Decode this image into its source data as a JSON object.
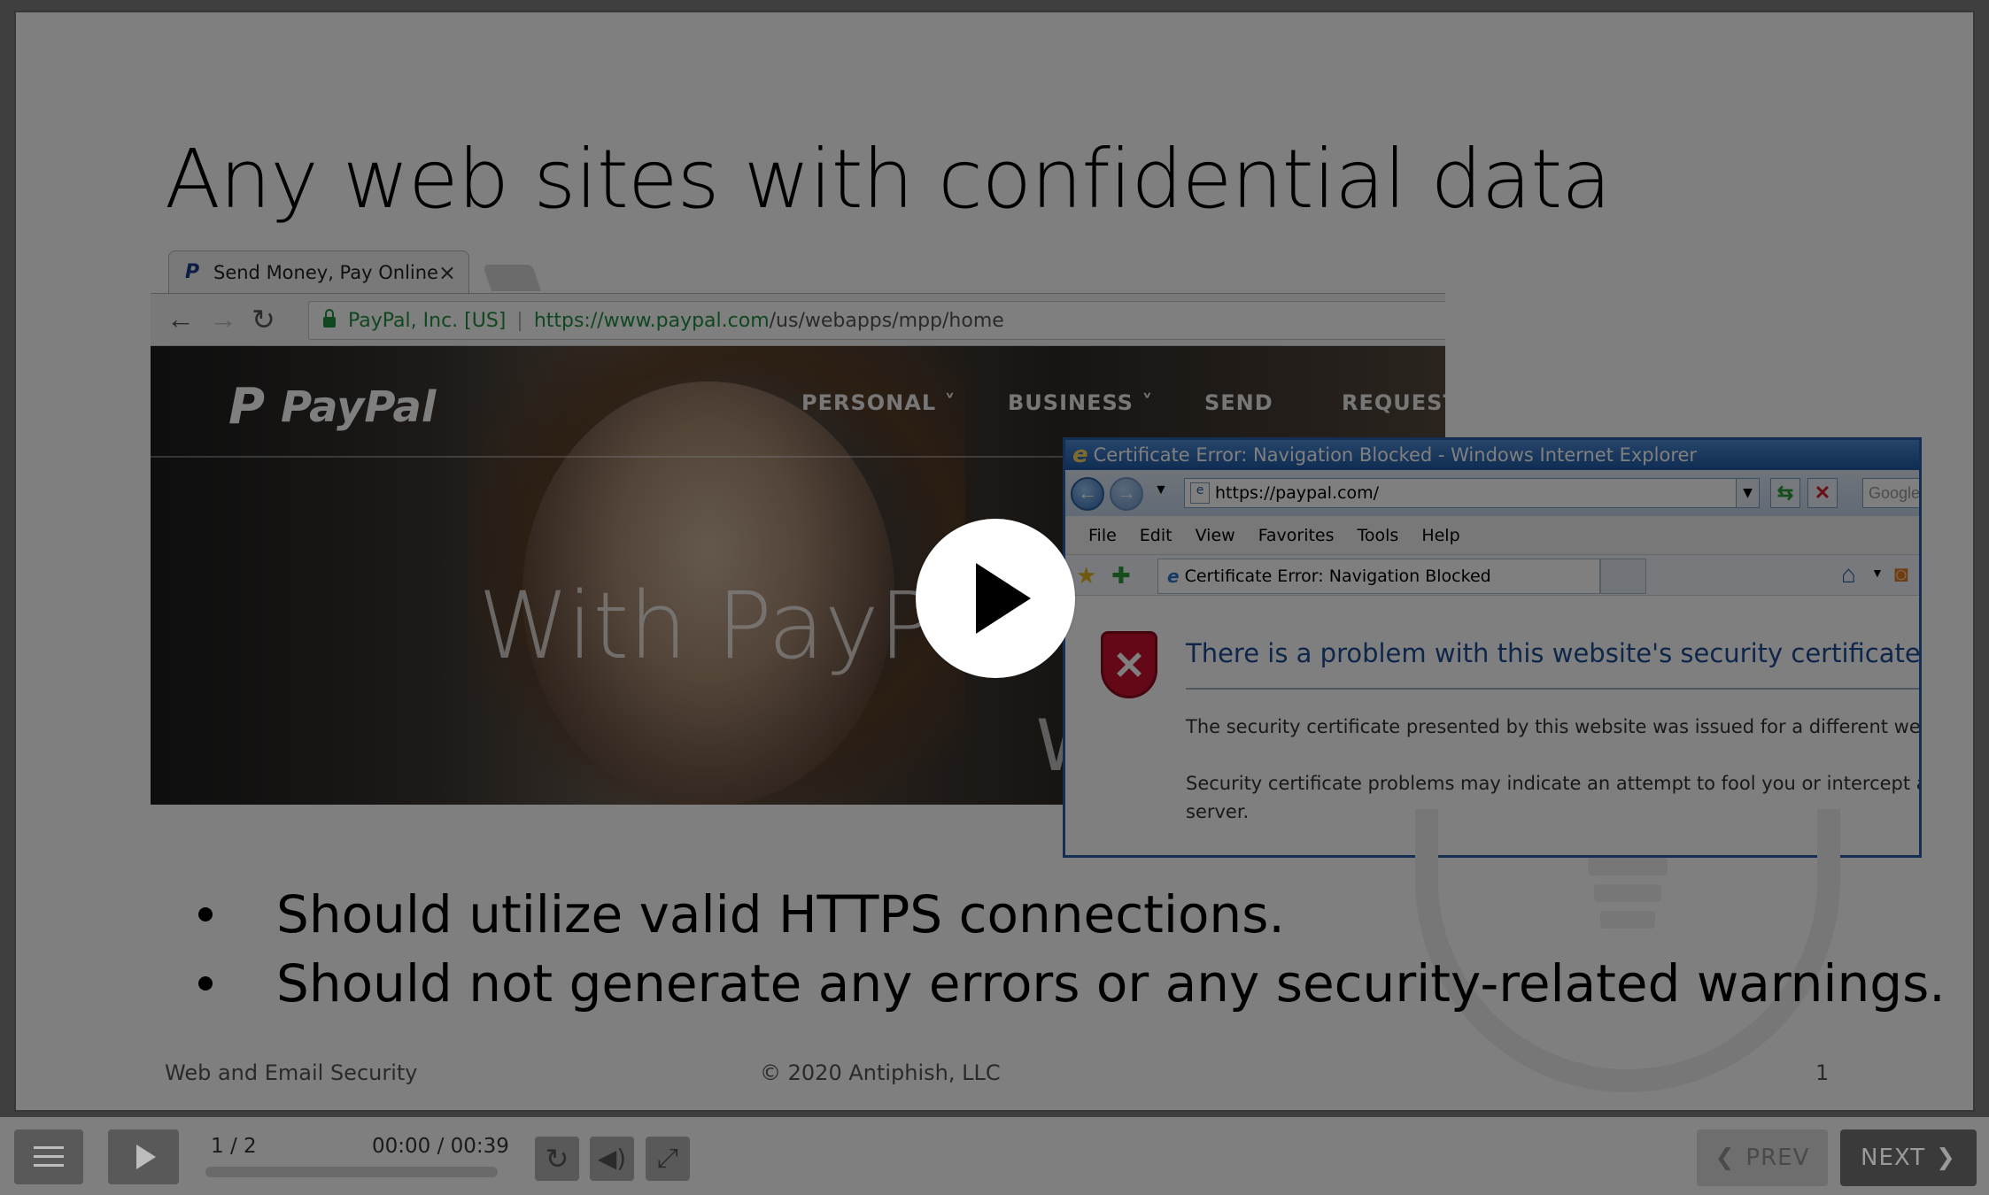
{
  "slide": {
    "title": "Any web sites with confidential data",
    "bullets": [
      "Should utilize valid HTTPS connections.",
      "Should not generate any errors or any security-related warnings."
    ],
    "footer_left": "Web and Email Security",
    "footer_center": "© 2020 Antiphish, LLC",
    "footer_right": "1"
  },
  "chrome_screenshot": {
    "tab_title": "Send Money, Pay Online",
    "tab_close": "×",
    "secure_org": "PayPal, Inc. [US]",
    "url_host": "https://www.paypal.com",
    "url_path": "/us/webapps/mpp/home",
    "logo": "PayPal",
    "menu": [
      "PERSONAL ˅",
      "BUSINESS ˅",
      "SEND",
      "REQUEST"
    ],
    "hero_text": "With PayPa",
    "hero_text2": "W"
  },
  "ie_screenshot": {
    "window_title": "Certificate Error: Navigation Blocked - Windows Internet Explorer",
    "address": "https://paypal.com/",
    "search_placeholder": "Google",
    "menus": [
      "File",
      "Edit",
      "View",
      "Favorites",
      "Tools",
      "Help"
    ],
    "tab_title": "Certificate Error: Navigation Blocked",
    "heading": "There is a problem with this website's security certificate.",
    "paragraph_1": "The security certificate presented by this website was issued for a different website",
    "paragraph_2_line_1": "Security certificate problems may indicate an attempt to fool you or intercept any",
    "paragraph_2_line_2": "server."
  },
  "player": {
    "slide_counter": "1 / 2",
    "timecode": "00:00 / 00:39",
    "progress": 0,
    "prev_label": "PREV",
    "next_label": "NEXT",
    "icons": [
      "menu-icon",
      "play-icon",
      "replay-icon",
      "volume-icon",
      "fullscreen-icon"
    ]
  },
  "colors": {
    "overlay": "rgba(0,0,0,0.5)",
    "control_button": "#595959",
    "next_button": "#3a3a3a",
    "ie_heading": "#1f4c97",
    "secure_green": "#1e8e3e"
  }
}
